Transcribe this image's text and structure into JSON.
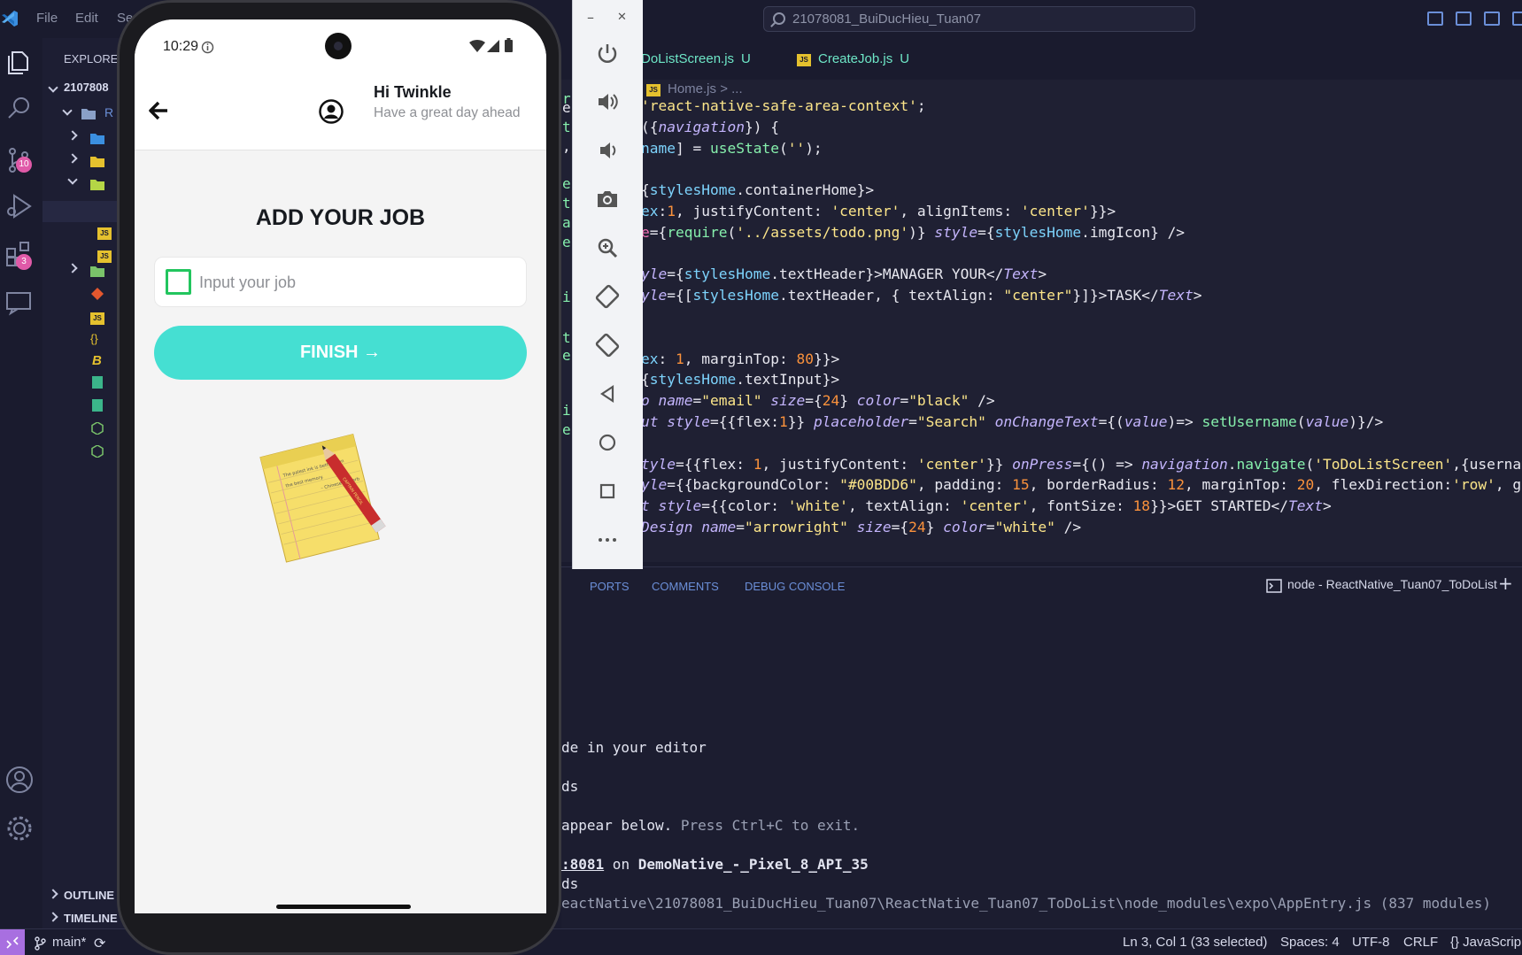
{
  "titlebar": {
    "menu": [
      "File",
      "Edit",
      "Se"
    ],
    "search_text": "21078081_BuiDucHieu_Tuan07"
  },
  "activitybar": {
    "scm_badge": "10",
    "extensions_badge": "3"
  },
  "sidebar": {
    "title": "EXPLORE",
    "root": "2107808",
    "folder_label": "R",
    "sections": [
      "OUTLINE",
      "TIMELINE"
    ]
  },
  "tabs": [
    {
      "label": "DoListScreen.js",
      "status": "U"
    },
    {
      "label": "CreateJob.js",
      "status": "U"
    }
  ],
  "breadcrumb": {
    "file": "Home.js",
    "rest": "> ..."
  },
  "editor": {
    "gutter_letters": [
      "r",
      "e",
      "t",
      ",",
      "e",
      "t",
      "a",
      "e",
      "i",
      "t",
      "e",
      "i",
      "e"
    ]
  },
  "panel": {
    "tabs": [
      "PORTS",
      "COMMENTS",
      "DEBUG CONSOLE"
    ],
    "terminal_title": "node - ReactNative_Tuan07_ToDoList",
    "lines": {
      "editor": "de in your editor",
      "ds1": "ds",
      "appear": "appear below.",
      "ctrlc": " Press Ctrl+C to exit.",
      "port": ":8081",
      "on": " on ",
      "device": "DemoNative_-_Pixel_8_API_35",
      "ds2": "ds",
      "path": "eactNative\\21078081_BuiDucHieu_Tuan07\\ReactNative_Tuan07_ToDoList\\node_modules\\expo\\AppEntry.js (837 modules)"
    }
  },
  "statusbar": {
    "branch": "main*",
    "cursor": "Ln 3, Col 1 (33 selected)",
    "spaces": "Spaces: 4",
    "encoding": "UTF-8",
    "eol": "CRLF",
    "language": "{} JavaScrip"
  },
  "emulator": {
    "minimize": "–",
    "close": "✕"
  },
  "phone": {
    "time": "10:29",
    "greeting": "Hi Twinkle",
    "subtitle": "Have a great day ahead",
    "heading": "ADD YOUR JOB",
    "input_placeholder": "Input your job",
    "finish_label": "FINISH →",
    "notepad_text_1": "The palest ink is better than",
    "notepad_text_2": "the best memory.",
    "notepad_text_3": "– Chinese Proverb",
    "pencil_text": "CAPTAIN PENCIL"
  },
  "colors": {
    "accent_teal": "#45dfd2",
    "checkbox_green": "#22c55e",
    "tab_green": "#6ee7c7"
  }
}
